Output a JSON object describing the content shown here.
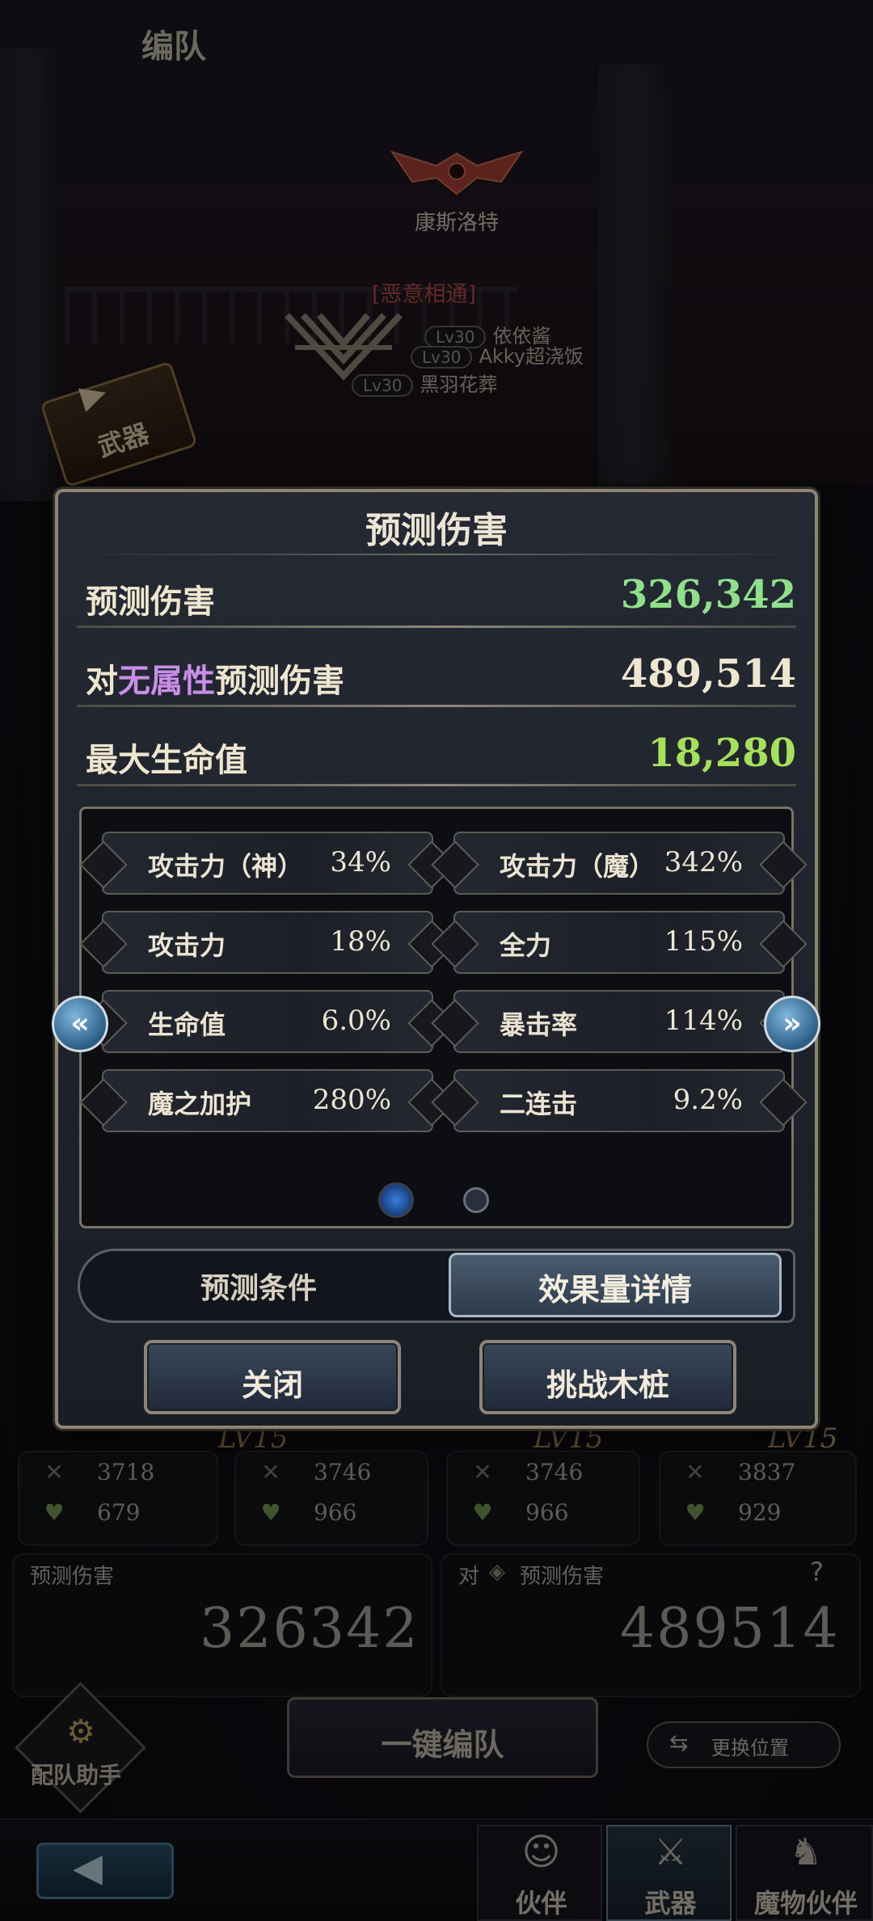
{
  "screen": {
    "title": "编队",
    "guild_name": "康斯洛特",
    "bond": {
      "title": "[恶意相通]",
      "members": [
        {
          "level": "Lv30",
          "name": "依依酱"
        },
        {
          "level": "Lv30",
          "name": "Akky超浇饭"
        },
        {
          "level": "Lv30",
          "name": "黑羽花葬"
        }
      ]
    },
    "weapon_tab_label": "武器"
  },
  "background": {
    "cards": [
      {
        "level": "LV15",
        "atk": "3718",
        "hp": "679"
      },
      {
        "level": "LV15",
        "atk": "3746",
        "hp": "966"
      },
      {
        "level": "LV15",
        "atk": "3746",
        "hp": "966"
      },
      {
        "level": "LV15",
        "atk": "3837",
        "hp": "929"
      }
    ],
    "predicted_damage": {
      "label": "预测伤害",
      "value": "326342"
    },
    "vs_damage": {
      "label_prefix": "对",
      "label": "预测伤害",
      "help": "?",
      "value": "489514"
    },
    "helper_label": "配队助手",
    "one_key_label": "一键编队",
    "swap_label": "更换位置",
    "nav": [
      {
        "label": "伙伴",
        "icon": "partner-icon"
      },
      {
        "label": "武器",
        "icon": "weapon-icon"
      },
      {
        "label": "魔物伙伴",
        "icon": "monster-icon"
      }
    ]
  },
  "dialog": {
    "title": "预测伤害",
    "summary": {
      "predicted": {
        "label": "预测伤害",
        "value": "326,342",
        "color": "#8fe08a"
      },
      "vs_attr": {
        "prefix": "对",
        "attr": "无属性",
        "suffix": "预测伤害",
        "value": "489,514",
        "color": "#efe6d0"
      },
      "max_hp": {
        "label": "最大生命值",
        "value": "18,280",
        "color": "#a7e05a"
      }
    },
    "stats": [
      {
        "name": "攻击力（神）",
        "value": "34%"
      },
      {
        "name": "攻击力（魔）",
        "value": "342%"
      },
      {
        "name": "攻击力",
        "value": "18%"
      },
      {
        "name": "全力",
        "value": "115%"
      },
      {
        "name": "生命值",
        "value": "6.0%"
      },
      {
        "name": "暴击率",
        "value": "114%"
      },
      {
        "name": "魔之加护",
        "value": "280%"
      },
      {
        "name": "二连击",
        "value": "9.2%"
      }
    ],
    "page": {
      "current": 1,
      "total": 2
    },
    "tabs": {
      "left": "预测条件",
      "right": "效果量详情",
      "active": "right"
    },
    "buttons": {
      "close": "关闭",
      "challenge": "挑战木桩"
    }
  }
}
